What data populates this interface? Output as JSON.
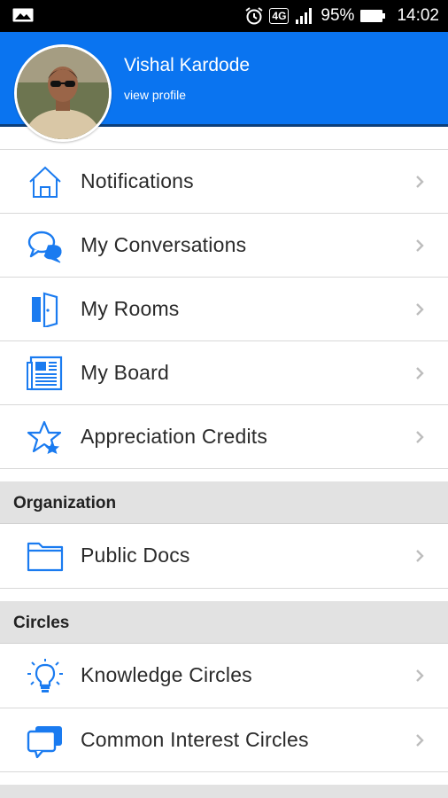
{
  "status_bar": {
    "network": "4G",
    "battery": "95%",
    "time": "14:02"
  },
  "profile": {
    "name": "Vishal Kardode",
    "link": "view profile"
  },
  "menu_items": [
    {
      "label": "Notifications",
      "icon": "home-icon"
    },
    {
      "label": "My Conversations",
      "icon": "chat-bubbles-icon"
    },
    {
      "label": "My Rooms",
      "icon": "door-icon"
    },
    {
      "label": "My Board",
      "icon": "newspaper-icon"
    },
    {
      "label": "Appreciation Credits",
      "icon": "star-icon"
    }
  ],
  "sections": [
    {
      "title": "Organization",
      "items": [
        {
          "label": "Public Docs",
          "icon": "folder-icon"
        }
      ]
    },
    {
      "title": "Circles",
      "items": [
        {
          "label": "Knowledge Circles",
          "icon": "lightbulb-icon"
        },
        {
          "label": "Common Interest Circles",
          "icon": "chat-box-icon"
        }
      ]
    }
  ],
  "colors": {
    "header_blue": "#0a74f0",
    "icon_blue": "#1a7bf0",
    "section_bg": "#e2e2e2"
  }
}
